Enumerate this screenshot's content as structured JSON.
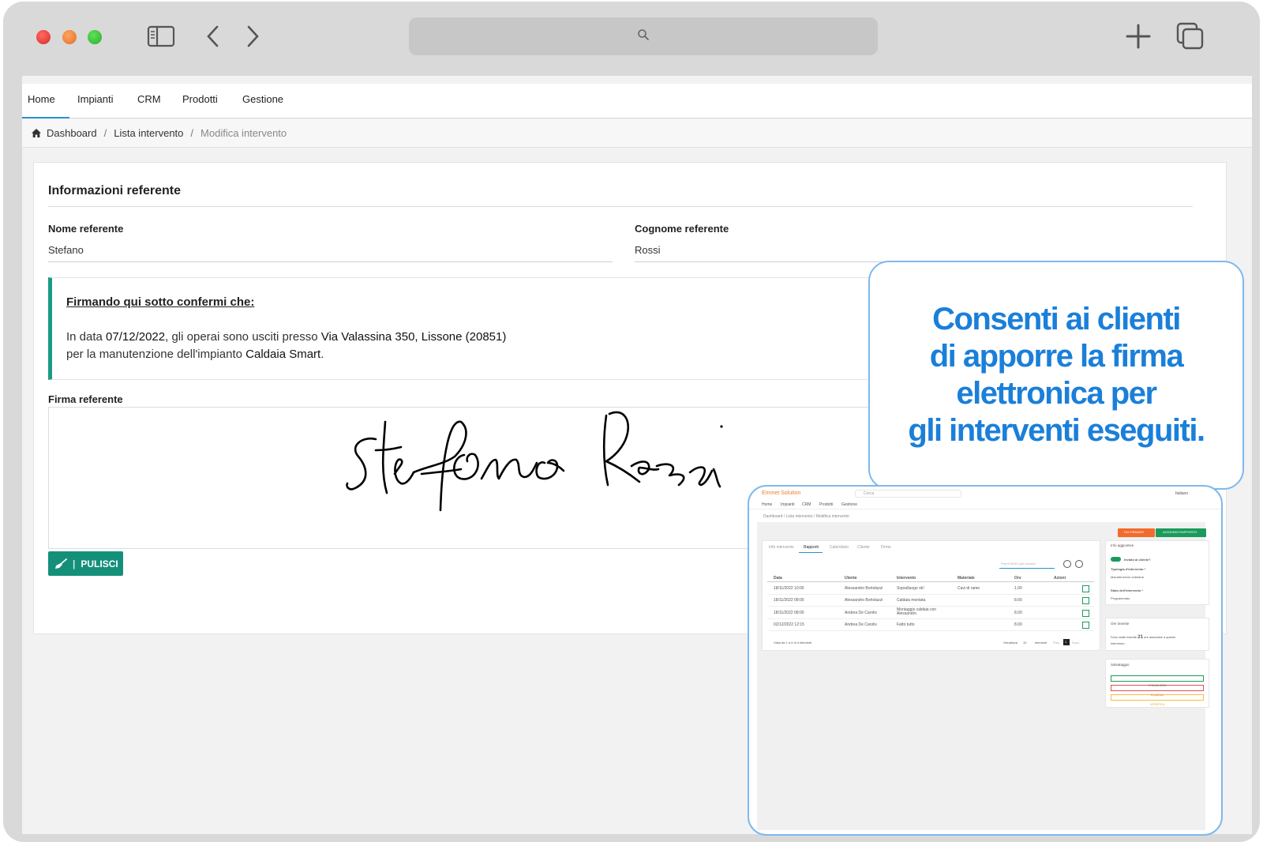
{
  "browser": {
    "icons": [
      "sidebar-toggle-icon",
      "back-chevron-icon",
      "forward-chevron-icon",
      "search-icon",
      "new-tab-icon",
      "tab-overview-icon"
    ]
  },
  "nav": {
    "items": [
      "Home",
      "Impianti",
      "CRM",
      "Prodotti",
      "Gestione"
    ]
  },
  "breadcrumb": {
    "items": [
      "Dashboard",
      "Lista intervento",
      "Modifica intervento"
    ]
  },
  "card": {
    "title": "Informazioni referente",
    "nome_label": "Nome referente",
    "nome_value": "Stefano",
    "cognome_label": "Cognome referente",
    "cognome_value": "Rossi"
  },
  "notice": {
    "title": "Firmando qui sotto confermi che:",
    "t1": "In data ",
    "date": "07/12/2022",
    "t2": ", gli operai sono usciti presso ",
    "address": "Via Valassina 350, Lissone (20851)",
    "t3": "per la manutenzione dell'impianto ",
    "system": "Caldaia Smart",
    "t4": "."
  },
  "signature": {
    "label": "Firma referente",
    "clear_button": "PULISCI"
  },
  "callout": {
    "lines": [
      "Consenti ai clienti",
      "di apporre la firma",
      "elettronica per",
      "gli interventi eseguiti."
    ],
    "color": "#1b7fd9"
  },
  "mini": {
    "brand": "Emmet Solution",
    "search_placeholder": "Cerca",
    "language": "Italiano",
    "nav": [
      "Home",
      "Impianti",
      "CRM",
      "Prodotti",
      "Gestione"
    ],
    "breadcrumb": "Dashboard / Lista intervento / Modifica intervento",
    "btn_sign": "FAI FIRMARE",
    "btn_add": "AGGIUNGI RAPPORTO",
    "tabs": [
      "Info intervento",
      "Rapporti",
      "Calendario",
      "Cliente",
      "Firme"
    ],
    "search_hint": "Premi INVIO per cercare",
    "columns": [
      "Data",
      "Utente",
      "Intervento",
      "Materiale",
      "Ore",
      "Azioni"
    ],
    "rows": [
      [
        "18/11/2022 10:00",
        "Alessandro Bortolazzi",
        "Sopralluogo ok!",
        "Cavi di rame",
        "1.00"
      ],
      [
        "18/11/2022 08:00",
        "Alessandro Bortolazzi",
        "Caldaia montata",
        "",
        "8.00"
      ],
      [
        "18/11/2022 08:00",
        "Andrea De Carolis",
        "Montaggio caldaia con Alessandro",
        "",
        "8.00"
      ],
      [
        "02/12/2022 12:15",
        "Andrea De Carolis",
        "Fatto tutto",
        "",
        "8.00"
      ]
    ],
    "footer": "Vista da 1 a 4 di 4 elementi",
    "visualizza": "Visualizza",
    "per_page": "10",
    "elementi": "elementi",
    "prev": "Prec.",
    "page": "1",
    "next": "Succ.",
    "side": {
      "info_title": "Info aggiuntive",
      "toggle_label": "Inviato al cliente?",
      "tipo_label": "Tipologia d'intervento *",
      "tipo_value": "Manutenzione ordinaria",
      "stato_label": "Stato dell'intervento *",
      "stato_value": "Programmato",
      "ore_title": "Ore inserite",
      "ore_t1": "Sono state inserite ",
      "ore_value": "21",
      "ore_t2": " ore associate a questo",
      "ore_t3": "intervento.",
      "save_title": "Salvataggio",
      "btn_view": "VISUALIZZA",
      "btn_delete": "ELIMINA",
      "btn_save": "VERIFICA"
    }
  }
}
